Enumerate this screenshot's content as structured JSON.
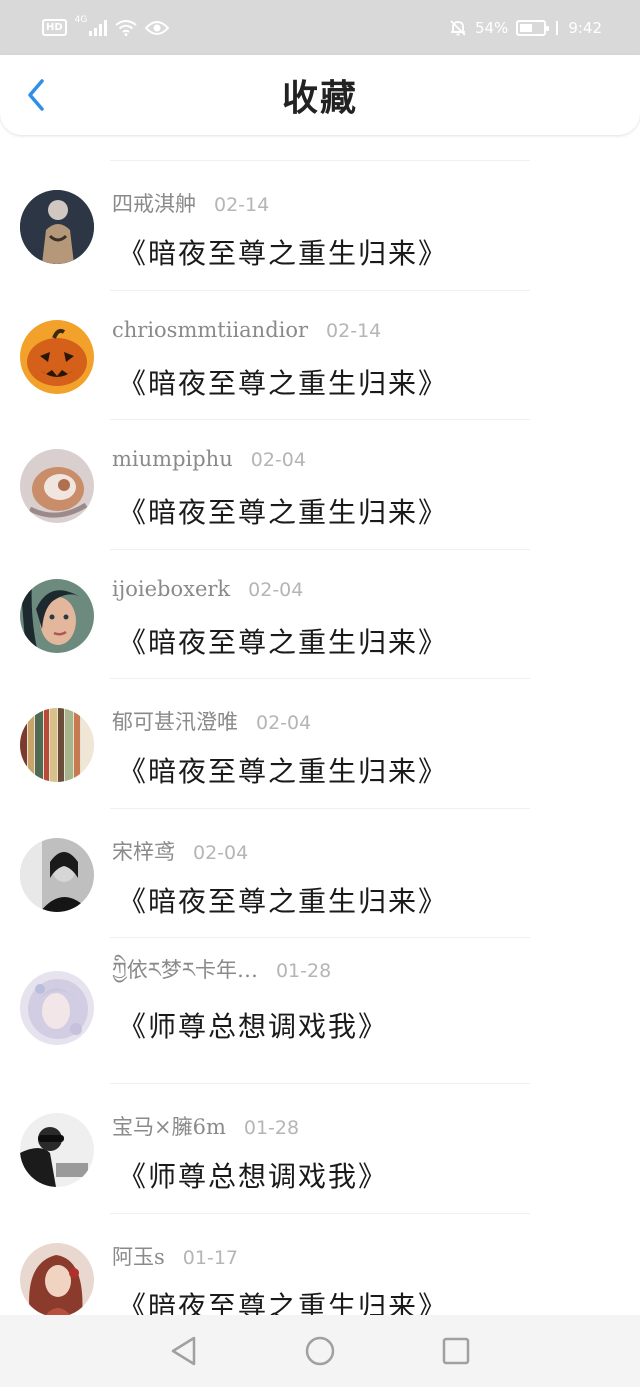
{
  "status_bar": {
    "hd": "HD",
    "network": "4G",
    "battery_percent": "54%",
    "battery_level": 0.54,
    "time": "9:42",
    "icons": [
      "hd-icon",
      "signal-icon",
      "wifi-icon",
      "eye-icon",
      "mute-bell-icon",
      "battery-icon"
    ]
  },
  "header": {
    "title": "收藏",
    "back_icon": "chevron-left-icon",
    "accent": "#2f8fe8"
  },
  "favorites": [
    {
      "user": "四戒淇舯",
      "date": "02-14",
      "title": "《暗夜至尊之重生归来》"
    },
    {
      "user": "chriosmmtiiandior",
      "date": "02-14",
      "title": "《暗夜至尊之重生归来》"
    },
    {
      "user": "miumpiphu",
      "date": "02-04",
      "title": "《暗夜至尊之重生归来》"
    },
    {
      "user": "ijoieboxerk",
      "date": "02-04",
      "title": "《暗夜至尊之重生归来》"
    },
    {
      "user": "郁可甚汛澄唯",
      "date": "02-04",
      "title": "《暗夜至尊之重生归来》"
    },
    {
      "user": "宋梓鸢",
      "date": "02-04",
      "title": "《暗夜至尊之重生归来》"
    },
    {
      "user": "ཀྱི依ར梦ར卡年…",
      "date": "01-28",
      "title": "《师尊总想调戏我》"
    },
    {
      "user": "宝马×臃6m",
      "date": "01-28",
      "title": "《师尊总想调戏我》"
    },
    {
      "user": "阿玉s",
      "date": "01-17",
      "title": "《暗夜至尊之重生归来》"
    }
  ],
  "nav_bar": {
    "icons": [
      "back-triangle-icon",
      "home-circle-icon",
      "recents-square-icon"
    ]
  }
}
